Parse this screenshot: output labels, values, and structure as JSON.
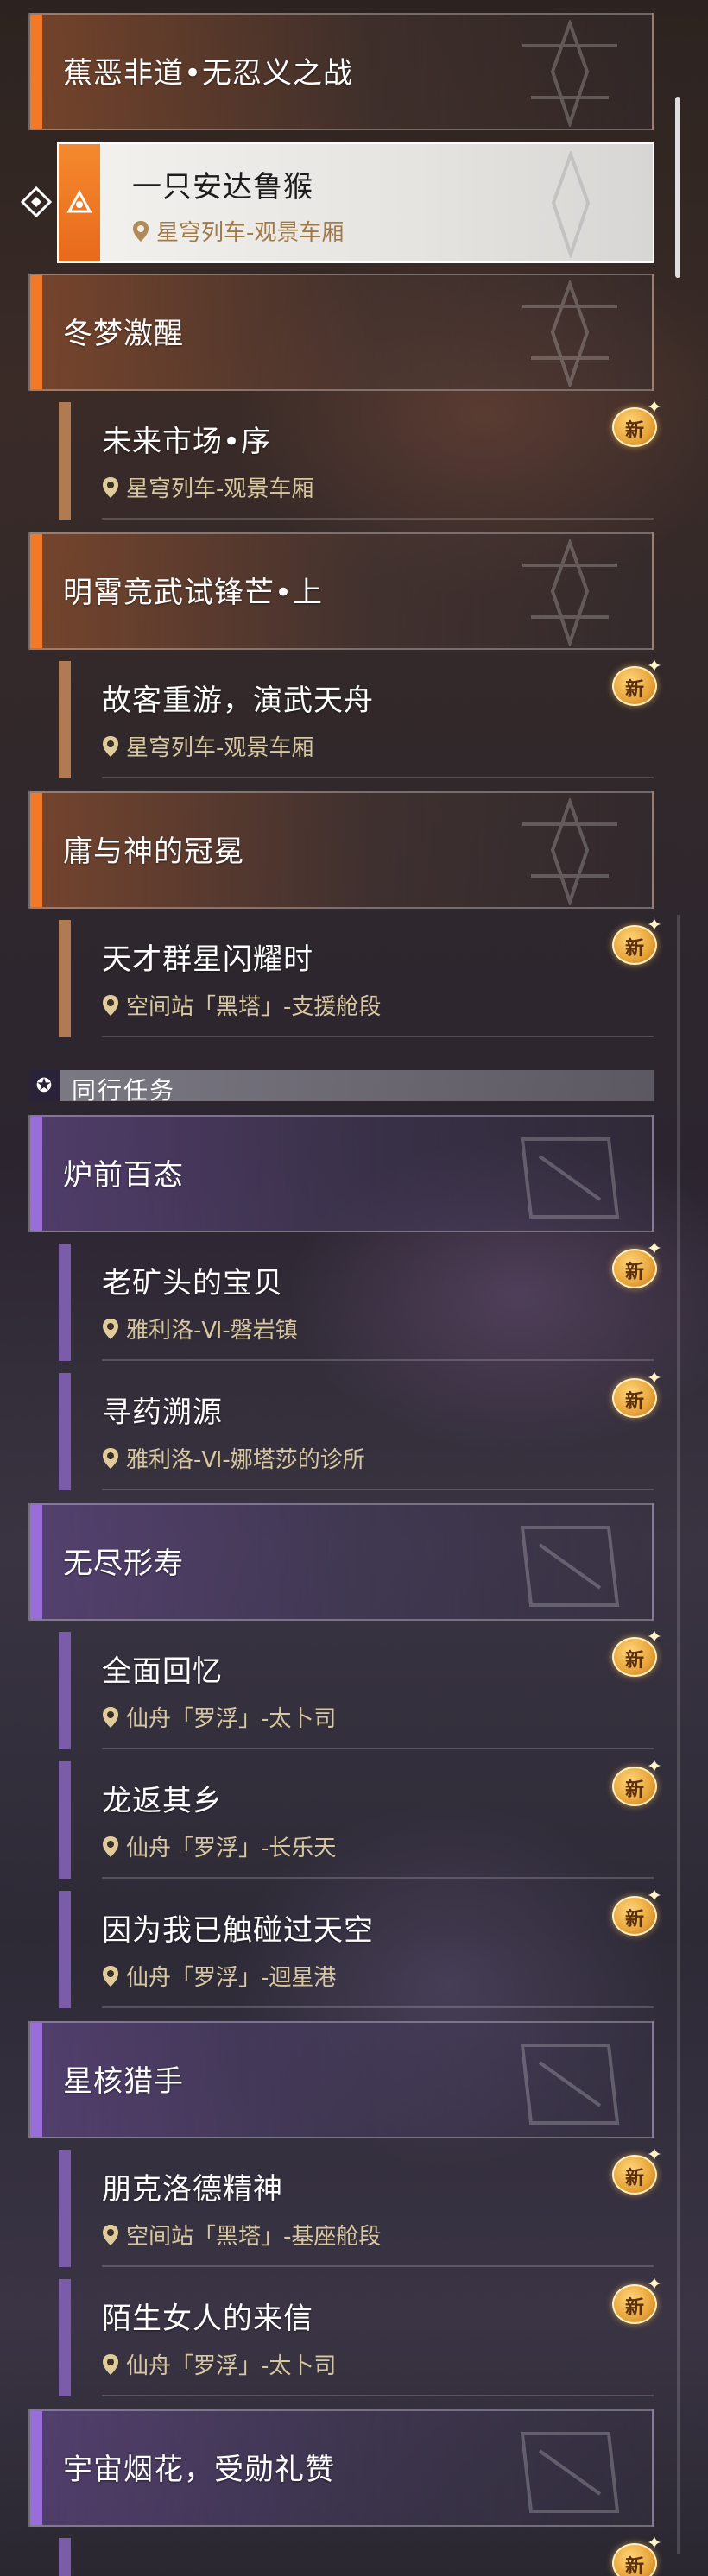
{
  "selected": {
    "title": "一只安达鲁猴",
    "location": "星穹列车-观景车厢"
  },
  "chapters": [
    {
      "title": "蕉恶非道•无忍义之战"
    },
    {
      "title": "冬梦激醒"
    },
    {
      "title": "明霄竞武试锋芒•上"
    },
    {
      "title": "庸与神的冠冕"
    },
    {
      "title": "炉前百态"
    },
    {
      "title": "无尽形寿"
    },
    {
      "title": "星核猎手"
    },
    {
      "title": "宇宙烟花，受勋礼赞"
    }
  ],
  "entries": [
    {
      "title": "未来市场•序",
      "location": "星穹列车-观景车厢"
    },
    {
      "title": "故客重游，演武天舟",
      "location": "星穹列车-观景车厢"
    },
    {
      "title": "天才群星闪耀时",
      "location": "空间站「黑塔」-支援舱段"
    },
    {
      "title": "老矿头的宝贝",
      "location": "雅利洛-Ⅵ-磐岩镇"
    },
    {
      "title": "寻药溯源",
      "location": "雅利洛-Ⅵ-娜塔莎的诊所"
    },
    {
      "title": "全面回忆",
      "location": "仙舟「罗浮」-太卜司"
    },
    {
      "title": "龙返其乡",
      "location": "仙舟「罗浮」-长乐天"
    },
    {
      "title": "因为我已触碰过天空",
      "location": "仙舟「罗浮」-迴星港"
    },
    {
      "title": "朋克洛德精神",
      "location": "空间站「黑塔」-基座舱段"
    },
    {
      "title": "陌生女人的来信",
      "location": "仙舟「罗浮」-太卜司"
    }
  ],
  "section": {
    "label": "同行任务",
    "icon": "star-icon"
  },
  "badge_label": "新",
  "colors": {
    "trailblaze_accent": "#f07a2a",
    "companion_accent": "#9a6ed8",
    "badge": "#e8a43a"
  }
}
